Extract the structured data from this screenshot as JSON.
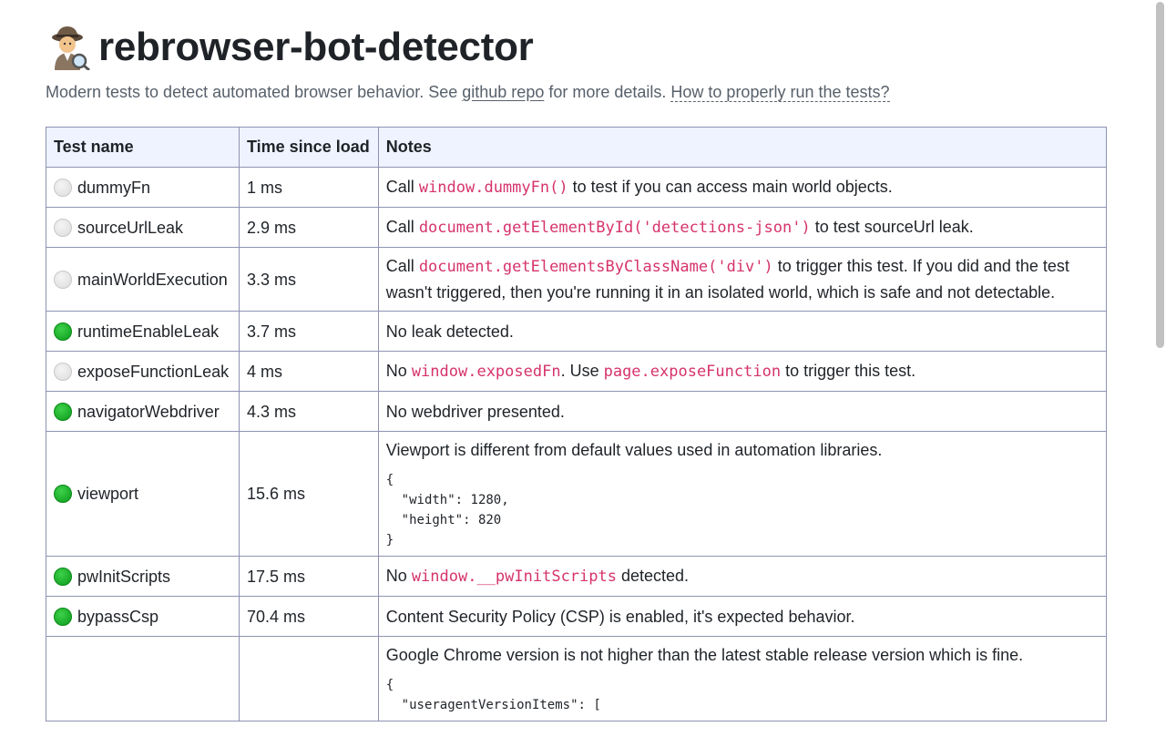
{
  "header": {
    "title": "rebrowser-bot-detector",
    "icon": "detective-icon",
    "subtitle_before": "Modern tests to detect automated browser behavior. See ",
    "subtitle_link": "github repo",
    "subtitle_middle": " for more details. ",
    "subtitle_help_link": "How to properly run the tests?"
  },
  "table": {
    "columns": [
      "Test name",
      "Time since load",
      "Notes"
    ],
    "rows": [
      {
        "status": "gray",
        "name": "dummyFn",
        "time": "1 ms",
        "notes": [
          {
            "t": "Call "
          },
          {
            "c": "window.dummyFn()"
          },
          {
            "t": " to test if you can access main world objects."
          }
        ]
      },
      {
        "status": "gray",
        "name": "sourceUrlLeak",
        "time": "2.9 ms",
        "notes": [
          {
            "t": "Call "
          },
          {
            "c": "document.getElementById('detections-json')"
          },
          {
            "t": " to test sourceUrl leak."
          }
        ]
      },
      {
        "status": "gray",
        "name": "mainWorldExecution",
        "time": "3.3 ms",
        "notes": [
          {
            "t": "Call "
          },
          {
            "c": "document.getElementsByClassName('div')"
          },
          {
            "t": " to trigger this test. If you did and the test wasn't triggered, then you're running it in an isolated world, which is safe and not detectable."
          }
        ]
      },
      {
        "status": "green",
        "name": "runtimeEnableLeak",
        "time": "3.7 ms",
        "notes": [
          {
            "t": "No leak detected."
          }
        ]
      },
      {
        "status": "gray",
        "name": "exposeFunctionLeak",
        "time": "4 ms",
        "notes": [
          {
            "t": "No "
          },
          {
            "c": "window.exposedFn"
          },
          {
            "t": ". Use "
          },
          {
            "c": "page.exposeFunction"
          },
          {
            "t": " to trigger this test."
          }
        ]
      },
      {
        "status": "green",
        "name": "navigatorWebdriver",
        "time": "4.3 ms",
        "notes": [
          {
            "t": "No webdriver presented."
          }
        ]
      },
      {
        "status": "green",
        "name": "viewport",
        "time": "15.6 ms",
        "notes": [
          {
            "t": "Viewport is different from default values used in automation libraries."
          }
        ],
        "pre": "{\n  \"width\": 1280,\n  \"height\": 820\n}"
      },
      {
        "status": "green",
        "name": "pwInitScripts",
        "time": "17.5 ms",
        "notes": [
          {
            "t": "No "
          },
          {
            "c": "window.__pwInitScripts"
          },
          {
            "t": " detected."
          }
        ]
      },
      {
        "status": "green",
        "name": "bypassCsp",
        "time": "70.4 ms",
        "notes": [
          {
            "t": "Content Security Policy (CSP) is enabled, it's expected behavior."
          }
        ]
      },
      {
        "status": "none",
        "name": "",
        "time": "",
        "notes": [
          {
            "t": "Google Chrome version is not higher than the latest stable release version which is fine."
          }
        ],
        "pre": "{\n  \"useragentVersionItems\": ["
      }
    ]
  },
  "colors": {
    "header_bg": "#eef3ff",
    "border": "#8f93b3",
    "code": "#d6336c",
    "status_green": "#0a9a1a",
    "status_gray": "#dcdcdc"
  }
}
